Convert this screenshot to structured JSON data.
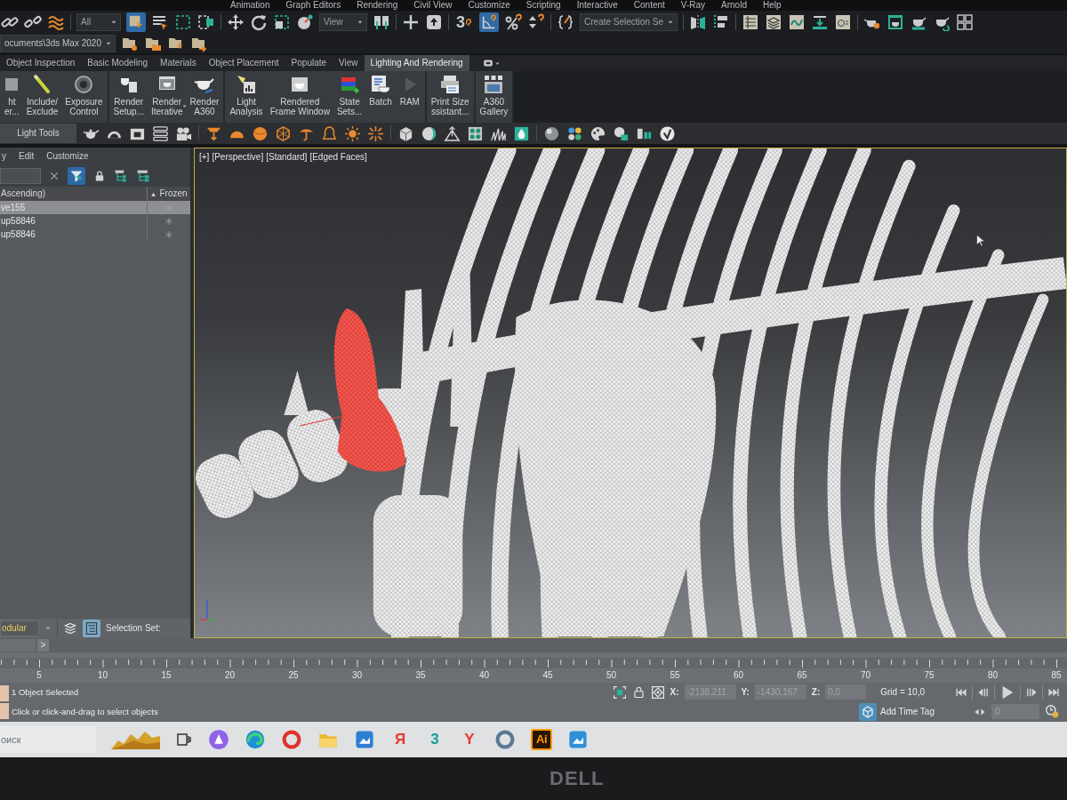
{
  "menu_bar": [
    "Animation",
    "Graph Editors",
    "Rendering",
    "Civil View",
    "Customize",
    "Scripting",
    "Interactive",
    "Content",
    "V-Ray",
    "Arnold",
    "Help"
  ],
  "main_toolbar": {
    "selection_filter": "All",
    "select_object_on": true,
    "coordinate_system": "View",
    "snaps_glyph": "3",
    "angle_snap_on": true,
    "named_selection_set": "Create Selection Se"
  },
  "project_bar": {
    "folder": "ocuments\\3ds Max 2020"
  },
  "ribbon": {
    "tabs": [
      {
        "label": "Object Inspection",
        "selected": false
      },
      {
        "label": "Basic Modeling",
        "selected": false
      },
      {
        "label": "Materials",
        "selected": false
      },
      {
        "label": "Object Placement",
        "selected": false
      },
      {
        "label": "Populate",
        "selected": false
      },
      {
        "label": "View",
        "selected": false
      },
      {
        "label": "Lighting And Rendering",
        "selected": true
      }
    ],
    "groups": [
      {
        "tools": [
          {
            "lines": [
              "ht",
              "er..."
            ],
            "menu": false
          },
          {
            "lines": [
              "Include/",
              "Exclude"
            ],
            "menu": false
          },
          {
            "lines": [
              "Exposure",
              "Control"
            ],
            "menu": false
          }
        ]
      },
      {
        "tools": [
          {
            "lines": [
              "Render",
              "Setup..."
            ],
            "menu": false
          },
          {
            "lines": [
              "Render",
              "Iterative"
            ],
            "menu": true
          },
          {
            "lines": [
              "Render",
              "A360"
            ],
            "menu": false
          }
        ]
      },
      {
        "tools": [
          {
            "lines": [
              "Light",
              "Analysis"
            ],
            "menu": false
          },
          {
            "lines": [
              "Rendered",
              "Frame Window"
            ],
            "menu": false
          },
          {
            "lines": [
              "State",
              "Sets..."
            ],
            "menu": false
          },
          {
            "lines": [
              "Batch"
            ],
            "menu": false
          },
          {
            "lines": [
              "RAM"
            ],
            "menu": false
          }
        ]
      },
      {
        "tools": [
          {
            "lines": [
              "Print Size",
              "ssistant..."
            ],
            "menu": false
          }
        ]
      },
      {
        "tools": [
          {
            "lines": [
              "A360",
              "Gallery"
            ],
            "menu": false
          }
        ]
      }
    ],
    "panel_title": "Light Tools"
  },
  "scene_explorer": {
    "menu": [
      "y",
      "Edit",
      "Customize"
    ],
    "filter_on": true,
    "columns": [
      "Ascending)",
      "Frozen"
    ],
    "rows": [
      {
        "name": "ve155",
        "selected": true
      },
      {
        "name": "up58846",
        "selected": false
      },
      {
        "name": "up58846",
        "selected": false
      }
    ],
    "workspace": "odular",
    "selection_set_on": true,
    "selection_set_label": "Selection Set:"
  },
  "time_slider": {
    "next": ">"
  },
  "viewport": {
    "active": true,
    "labels": [
      "[+]",
      "[Perspective]",
      "[Standard]",
      "[Edged Faces]"
    ]
  },
  "timeline": {
    "frame_labels": [
      "5",
      "10",
      "15",
      "20",
      "25",
      "30",
      "35",
      "40",
      "45",
      "50",
      "55",
      "60",
      "65",
      "70",
      "75",
      "80",
      "85"
    ]
  },
  "status_bar": {
    "selection": "1 Object Selected",
    "prompt": "Click or click-and-drag to select objects",
    "coordinates": [
      {
        "label": "X:",
        "value": "-2138,211"
      },
      {
        "label": "Y:",
        "value": "-1430,167"
      },
      {
        "label": "Z:",
        "value": "0,0"
      }
    ],
    "grid": "Grid = 10,0",
    "add_time_tag": "Add Time Tag",
    "frame": "0"
  },
  "taskbar": {
    "search": {
      "placeholder": "оиск"
    },
    "items": [
      {
        "kind": "widget"
      },
      {
        "kind": "task-view"
      },
      {
        "kind": "disc",
        "color": "#8e63e6"
      },
      {
        "kind": "swirl"
      },
      {
        "kind": "ring",
        "color": "#e2312d"
      },
      {
        "kind": "folder"
      },
      {
        "kind": "tile",
        "color": "#2d7fd4"
      },
      {
        "kind": "letter",
        "glyph": "Я",
        "color": "#e6392c"
      },
      {
        "kind": "letter",
        "glyph": "3",
        "color": "#169c98"
      },
      {
        "kind": "letter",
        "glyph": "Y",
        "color": "#e6392c"
      },
      {
        "kind": "ring",
        "color": "#5b7893"
      },
      {
        "kind": "badge",
        "glyph": "Ai",
        "color": "#ff9a00"
      },
      {
        "kind": "tile",
        "color": "#2f90d8"
      }
    ]
  },
  "bezel_logo": "DELL"
}
